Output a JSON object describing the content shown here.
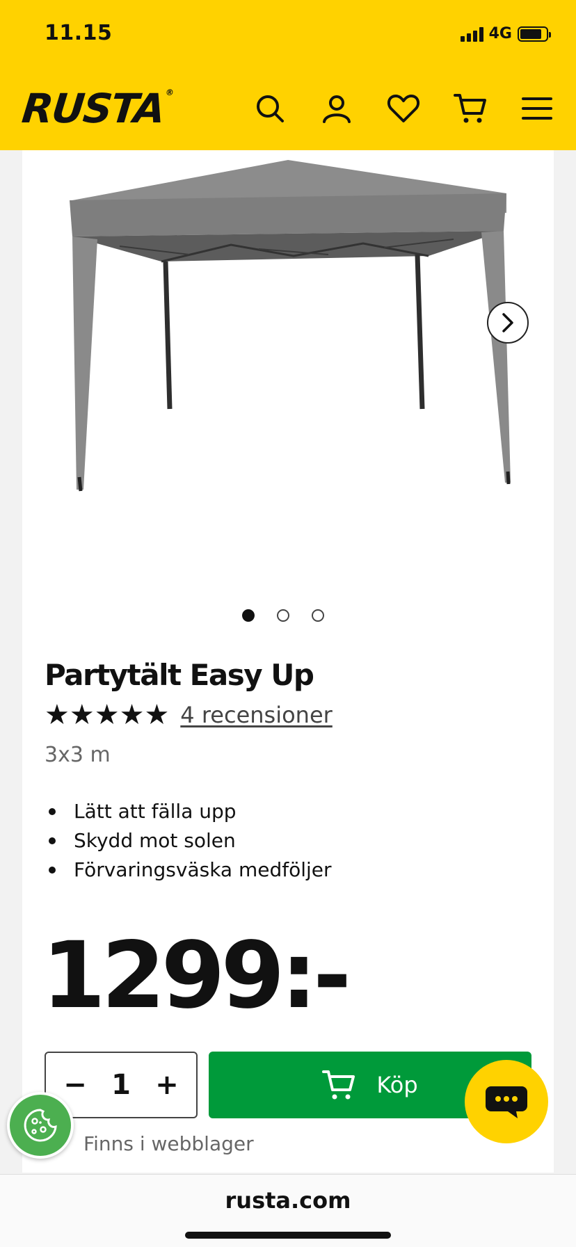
{
  "status_bar": {
    "time": "11.15",
    "network": "4G"
  },
  "header": {
    "logo": "RUSTA",
    "logo_mark": "®",
    "icons": [
      "search-icon",
      "account-icon",
      "heart-icon",
      "cart-icon",
      "menu-icon"
    ],
    "brand_color": "#ffd200"
  },
  "gallery": {
    "image_count": 3,
    "active_index": 0
  },
  "product": {
    "title": "Partytält Easy Up",
    "rating": 5,
    "reviews_label": "4 recensioner",
    "size": "3x3 m",
    "features": [
      "Lätt att fälla upp",
      "Skydd mot solen",
      "Förvaringsväska medföljer"
    ],
    "price": "1299:-"
  },
  "purchase": {
    "quantity": "1",
    "minus": "−",
    "plus": "+",
    "buy_label": "Köp",
    "buy_color": "#009a3a",
    "stock_label": "Finns i webblager"
  },
  "browser": {
    "url": "rusta.com"
  }
}
